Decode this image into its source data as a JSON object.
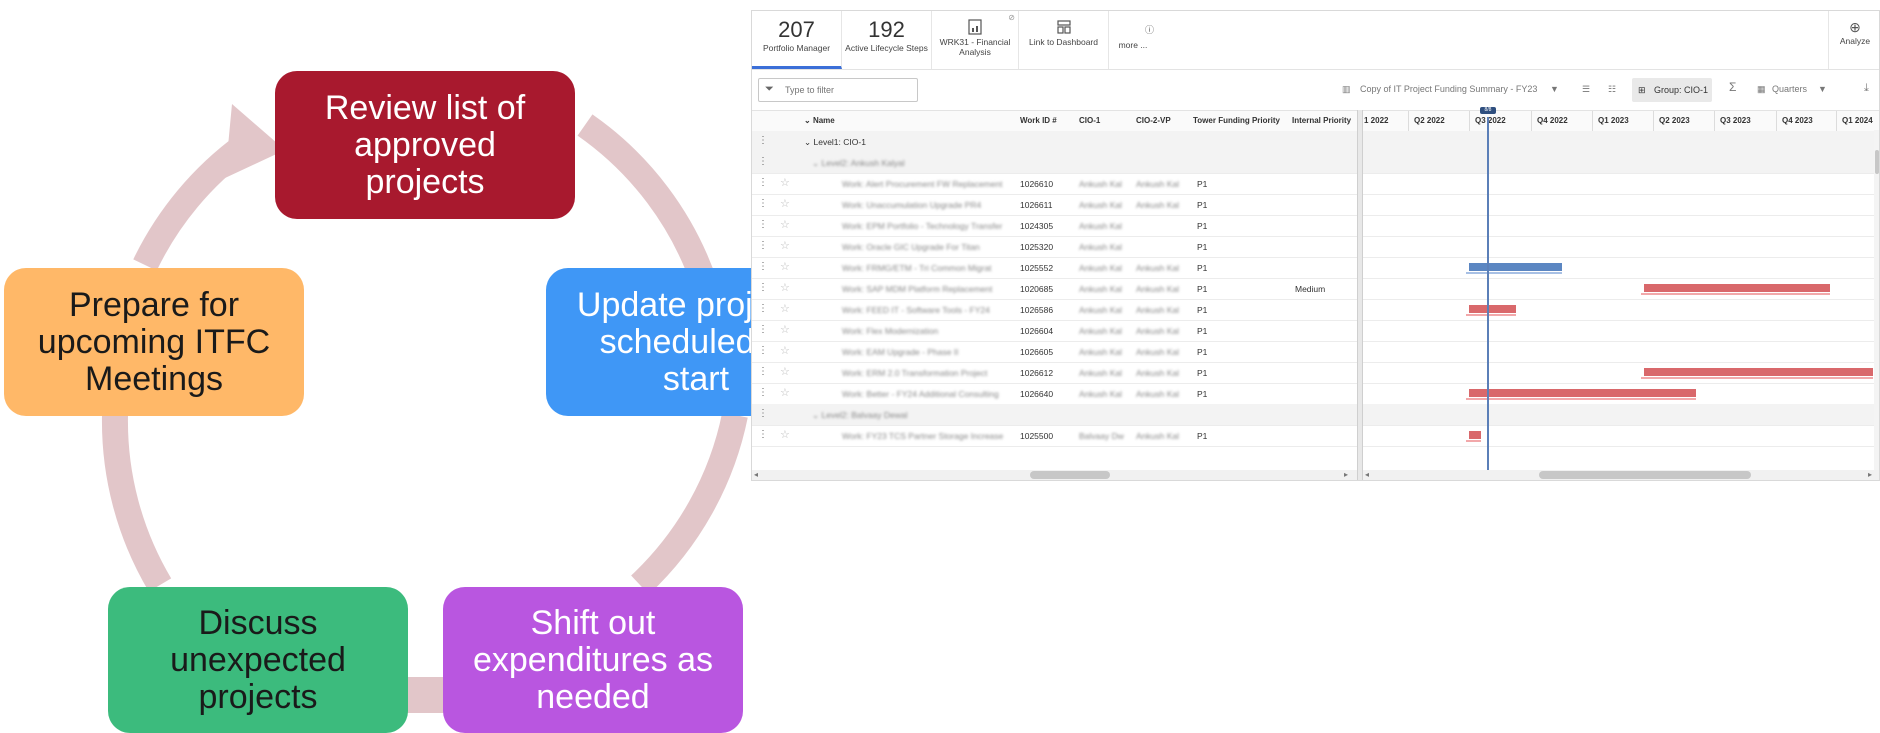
{
  "cycle": {
    "colors": {
      "arrow": "#e2c6c9",
      "review": "#a8192e",
      "update": "#3f97f6",
      "shift": "#b956e0",
      "discuss": "#3cbb7d",
      "prepare": "#ffb868"
    },
    "steps": {
      "review": "Review list of\napproved\nprojects",
      "update": "Update projects\nscheduled to\nstart",
      "shift": "Shift out\nexpenditures as\nneeded",
      "discuss": "Discuss\nunexpected\nprojects",
      "prepare": "Prepare for\nupcoming ITFC\nMeetings"
    }
  },
  "app": {
    "tiles": {
      "portfolio_count": "207",
      "portfolio_label": "Portfolio Manager",
      "lifecycle_count": "192",
      "lifecycle_label": "Active Lifecycle Steps",
      "financial_label": "WRK31 - Financial Analysis",
      "dashboard_label": "Link to Dashboard",
      "more_label": "more ...",
      "analyze_label": "Analyze"
    },
    "toolbar": {
      "filter_placeholder": "Type to filter",
      "view_name": "Copy of IT Project Funding Summary - FY23",
      "group_label": "Group: CIO-1",
      "timescale": "Quarters"
    },
    "columns": {
      "name": "Name",
      "work_id": "Work ID #",
      "cio1": "CIO-1",
      "cio2": "CIO-2-VP",
      "tower_priority": "Tower Funding Priority",
      "internal_priority": "Internal Priority"
    },
    "quarters": [
      "1 2022",
      "Q2 2022",
      "Q3 2022",
      "Q4 2022",
      "Q1 2023",
      "Q2 2023",
      "Q3 2023",
      "Q4 2023",
      "Q1 2024"
    ],
    "today_tag": "8/8",
    "level1": "Level1: CIO-1",
    "level2a": "Level2: Ankush Kalyal",
    "level2b": "Level2: Balvaay Dewal",
    "rows": [
      {
        "name": "Work: Alert Procurement FW Replacement",
        "id": "1026610",
        "cio1": "Ankush Kal",
        "cio2": "Ankush Kal",
        "priority": "P1",
        "internal": ""
      },
      {
        "name": "Work: Unaccumulation Upgrade PR4",
        "id": "1026611",
        "cio1": "Ankush Kal",
        "cio2": "Ankush Kal",
        "priority": "P1",
        "internal": ""
      },
      {
        "name": "Work: EPM Portfolio - Technology Transfer",
        "id": "1024305",
        "cio1": "Ankush Kal",
        "cio2": "",
        "priority": "P1",
        "internal": ""
      },
      {
        "name": "Work: Oracle GIC Upgrade For Titan",
        "id": "1025320",
        "cio1": "Ankush Kal",
        "cio2": "",
        "priority": "P1",
        "internal": ""
      },
      {
        "name": "Work: FRMG/ETM - Tri Common Migrat",
        "id": "1025552",
        "cio1": "Ankush Kal",
        "cio2": "Ankush Kal",
        "priority": "P1",
        "internal": ""
      },
      {
        "name": "Work: SAP MDM Platform Replacement",
        "id": "1020685",
        "cio1": "Ankush Kal",
        "cio2": "Ankush Kal",
        "priority": "P1",
        "internal": "Medium"
      },
      {
        "name": "Work: FEED IT - Software Tools - FY24",
        "id": "1026586",
        "cio1": "Ankush Kal",
        "cio2": "Ankush Kal",
        "priority": "P1",
        "internal": ""
      },
      {
        "name": "Work: Flex Modernization",
        "id": "1026604",
        "cio1": "Ankush Kal",
        "cio2": "Ankush Kal",
        "priority": "P1",
        "internal": ""
      },
      {
        "name": "Work: EAM Upgrade - Phase II",
        "id": "1026605",
        "cio1": "Ankush Kal",
        "cio2": "Ankush Kal",
        "priority": "P1",
        "internal": ""
      },
      {
        "name": "Work: ERM 2.0 Transformation Project",
        "id": "1026612",
        "cio1": "Ankush Kal",
        "cio2": "Ankush Kal",
        "priority": "P1",
        "internal": ""
      },
      {
        "name": "Work: Better - FY24 Additional Consulting",
        "id": "1026640",
        "cio1": "Ankush Kal",
        "cio2": "Ankush Kal",
        "priority": "P1",
        "internal": ""
      }
    ],
    "row_b": {
      "name": "Work: FY23 TCS Partner Storage Increase",
      "id": "1025500",
      "cio1": "Balvaay Dw",
      "cio2": "Ankush Kal",
      "priority": "P1"
    }
  }
}
